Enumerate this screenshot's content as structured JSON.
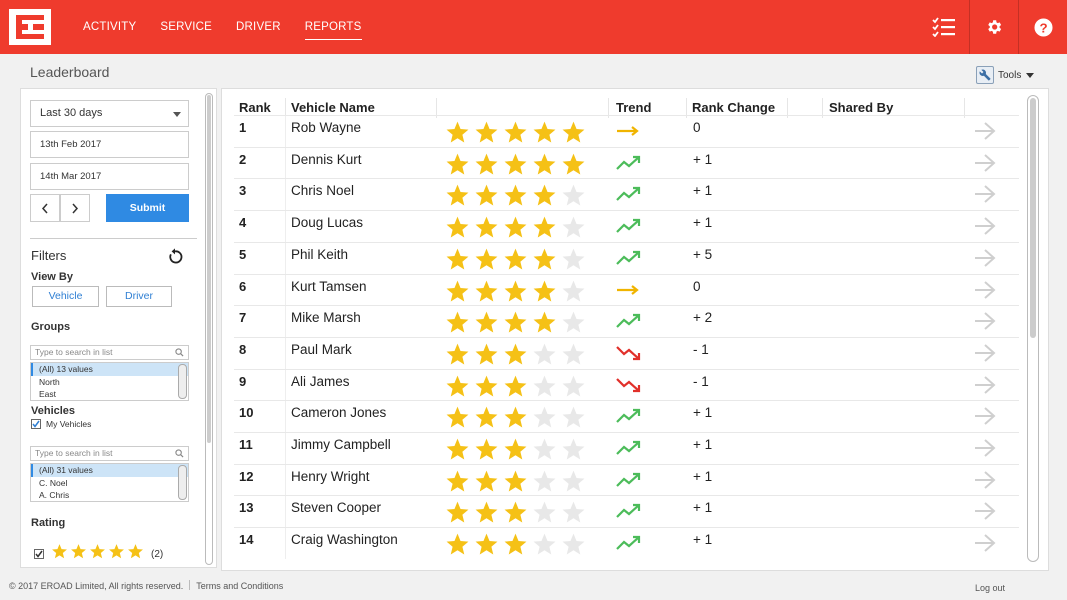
{
  "nav": {
    "items": [
      "ACTIVITY",
      "SERVICE",
      "DRIVER",
      "REPORTS"
    ],
    "active": "REPORTS",
    "icons": [
      "checklist-icon",
      "gear-icon",
      "help-icon"
    ]
  },
  "colors": {
    "brand": "#ef3b2d",
    "star": "#f5c116",
    "star_empty": "#e8e8e8",
    "trend_up": "#4cbc5a",
    "trend_down": "#e1302a",
    "trend_flat": "#f0b400",
    "primary": "#2f8ae3"
  },
  "page": {
    "title": "Leaderboard",
    "tools_label": "Tools"
  },
  "sidebar": {
    "period": "Last 30 days",
    "date_from": "13th Feb 2017",
    "date_to": "14th Mar 2017",
    "submit_label": "Submit",
    "filters_title": "Filters",
    "view_by_label": "View By",
    "view_by_options": [
      "Vehicle",
      "Driver"
    ],
    "groups_label": "Groups",
    "groups_search_placeholder": "Type to search in list",
    "groups_items": [
      "(All) 13 values",
      "North",
      "East"
    ],
    "vehicles_label": "Vehicles",
    "my_vehicles_label": "My Vehicles",
    "vehicles_search_placeholder": "Type to search in list",
    "vehicles_items": [
      "(All) 31 values",
      "C. Noel",
      "A. Chris"
    ],
    "rating_label": "Rating",
    "rating_option": {
      "stars": 5,
      "count": "(2)"
    }
  },
  "table": {
    "headers": {
      "rank": "Rank",
      "vehicle": "Vehicle Name",
      "trend": "Trend",
      "rank_change": "Rank Change",
      "shared_by": "Shared By"
    },
    "rows": [
      {
        "rank": "1",
        "name": "Rob Wayne",
        "stars": 5,
        "trend": "flat",
        "change": "0"
      },
      {
        "rank": "2",
        "name": "Dennis Kurt",
        "stars": 5,
        "trend": "up",
        "change": "+ 1"
      },
      {
        "rank": "3",
        "name": "Chris Noel",
        "stars": 4,
        "trend": "up",
        "change": "+ 1"
      },
      {
        "rank": "4",
        "name": "Doug Lucas",
        "stars": 4,
        "trend": "up",
        "change": "+ 1"
      },
      {
        "rank": "5",
        "name": "Phil Keith",
        "stars": 4,
        "trend": "up",
        "change": "+ 5"
      },
      {
        "rank": "6",
        "name": "Kurt Tamsen",
        "stars": 4,
        "trend": "flat",
        "change": "0"
      },
      {
        "rank": "7",
        "name": "Mike Marsh",
        "stars": 4,
        "trend": "up",
        "change": "+ 2"
      },
      {
        "rank": "8",
        "name": "Paul Mark",
        "stars": 3,
        "trend": "down",
        "change": "- 1"
      },
      {
        "rank": "9",
        "name": "Ali James",
        "stars": 3,
        "trend": "down",
        "change": "- 1"
      },
      {
        "rank": "10",
        "name": "Cameron Jones",
        "stars": 3,
        "trend": "up",
        "change": "+ 1"
      },
      {
        "rank": "11",
        "name": "Jimmy Campbell",
        "stars": 3,
        "trend": "up",
        "change": "+ 1"
      },
      {
        "rank": "12",
        "name": "Henry Wright",
        "stars": 3,
        "trend": "up",
        "change": "+ 1"
      },
      {
        "rank": "13",
        "name": "Steven Cooper",
        "stars": 3,
        "trend": "up",
        "change": "+ 1"
      },
      {
        "rank": "14",
        "name": "Craig Washington",
        "stars": 3,
        "trend": "up",
        "change": "+ 1"
      }
    ]
  },
  "footer": {
    "copyright": "© 2017 EROAD Limited, All rights reserved.",
    "terms": "Terms and Conditions",
    "logout": "Log out"
  }
}
